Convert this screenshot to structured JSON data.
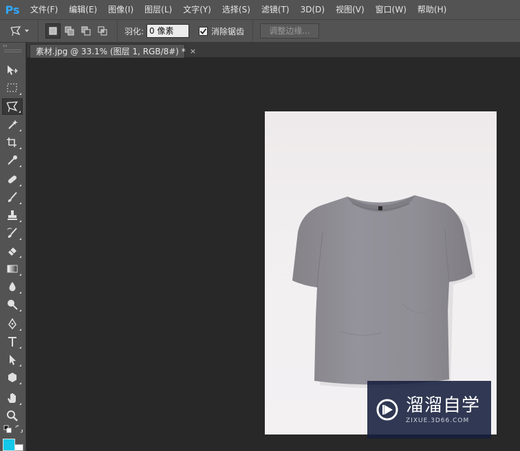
{
  "app": {
    "logo_text": "Ps"
  },
  "menu": {
    "items": [
      "文件(F)",
      "编辑(E)",
      "图像(I)",
      "图层(L)",
      "文字(Y)",
      "选择(S)",
      "滤镜(T)",
      "3D(D)",
      "视图(V)",
      "窗口(W)",
      "帮助(H)"
    ]
  },
  "options": {
    "tool_icon": "polygonal-lasso-icon",
    "selection_modes": [
      "new-selection",
      "add-to-selection",
      "subtract-from-selection",
      "intersect-selection"
    ],
    "feather_label": "羽化:",
    "feather_value": "0 像素",
    "antialias_label": "消除锯齿",
    "antialias_checked": true,
    "refine_edge_label": "调整边缘..."
  },
  "toolbox": {
    "tools": [
      "move-tool-icon",
      "rectangular-marquee-icon",
      "polygonal-lasso-icon",
      "magic-wand-icon",
      "crop-icon",
      "eyedropper-icon",
      "spot-healing-brush-icon",
      "brush-icon",
      "clone-stamp-icon",
      "history-brush-icon",
      "eraser-icon",
      "gradient-icon",
      "blur-icon",
      "dodge-icon",
      "pen-icon",
      "type-icon",
      "path-selection-icon",
      "shape-icon",
      "hand-icon",
      "zoom-icon"
    ],
    "active_tool": "polygonal-lasso-icon",
    "foreground_color": "#13c8e8",
    "background_color": "#ffffff"
  },
  "document": {
    "tab_title": "素材.jpg @ 33.1% (图层 1, RGB/8#) *",
    "close_symbol": "×"
  },
  "watermark": {
    "title": "溜溜自学",
    "url": "ZIXUE.3D66.COM"
  },
  "colors": {
    "panel": "#535353",
    "canvas_bg": "#282828",
    "shirt": "#8f8d92",
    "accent": "#31a8ff"
  }
}
